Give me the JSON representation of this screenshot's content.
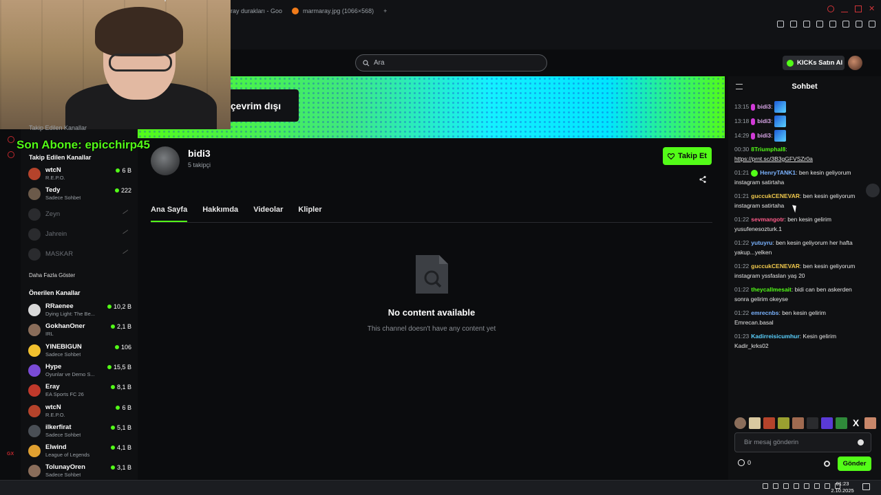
{
  "browser": {
    "tabs": [
      {
        "label": "ray durakları - Goo"
      },
      {
        "label": "marmaray.jpg (1066×568)"
      }
    ],
    "new_tab_label": "+"
  },
  "header": {
    "search_placeholder": "Ara",
    "kicks_label": "KICKs Satın Al"
  },
  "banner": {
    "status_label": "çevrim dışı"
  },
  "overlay": {
    "last_sub_text": "Son Abone: epicchirp45"
  },
  "sidebar": {
    "partial_heading": "Takip Edilen Kanallar",
    "following_heading": "Takip Edilen Kanallar",
    "following": [
      {
        "name": "wtcN",
        "sub": "R.E.P.O.",
        "viewers": "6 B",
        "live": true,
        "color": "#b5432b"
      },
      {
        "name": "Tedy",
        "sub": "Sadece Sohbet",
        "viewers": "222",
        "live": true,
        "color": "#6b5a4a"
      },
      {
        "name": "Zeyn",
        "live": false
      },
      {
        "name": "Jahrein",
        "live": false
      },
      {
        "name": "MASKAR",
        "live": false
      }
    ],
    "show_more": "Daha Fazla Göster",
    "suggested_heading": "Önerilen Kanallar",
    "suggested": [
      {
        "name": "RRaenee",
        "sub": "Dying Light: The Be...",
        "viewers": "10,2 B",
        "color": "#d9d9d9"
      },
      {
        "name": "GokhanOner",
        "sub": "IRL",
        "viewers": "2,1 B",
        "color": "#8a6d5a"
      },
      {
        "name": "YINEBIGUN",
        "sub": "Sadece Sohbet",
        "viewers": "106",
        "color": "#f2c12e"
      },
      {
        "name": "Hype",
        "sub": "Oyunlar ve Demo S...",
        "viewers": "15,5 B",
        "color": "#7a4bd6"
      },
      {
        "name": "Eray",
        "sub": "EA Sports FC 26",
        "viewers": "8,1 B",
        "color": "#c0392b"
      },
      {
        "name": "wtcN",
        "sub": "R.E.P.O.",
        "viewers": "6 B",
        "color": "#b5432b"
      },
      {
        "name": "ilkerfirat",
        "sub": "Sadece Sohbet",
        "viewers": "5,1 B",
        "color": "#4a4f55"
      },
      {
        "name": "Elwind",
        "sub": "League of Legends",
        "viewers": "4,1 B",
        "color": "#e0a030"
      },
      {
        "name": "TolunayOren",
        "sub": "Sadece Sohbet",
        "viewers": "3,1 B",
        "color": "#8a6d5a"
      }
    ],
    "rail_label": "GX"
  },
  "channel": {
    "name": "bidi3",
    "followers": "5 takipçi",
    "follow_label": "Takip Et",
    "tabs": [
      "Ana Sayfa",
      "Hakkımda",
      "Videolar",
      "Klipler"
    ],
    "empty_title": "No content available",
    "empty_subtitle": "This channel doesn't have any content yet"
  },
  "chat": {
    "title": "Sohbet",
    "messages": [
      {
        "time": "13:15",
        "user": "bidi3",
        "text": "",
        "emote": true,
        "color": "#d9a7e8"
      },
      {
        "time": "13:18",
        "user": "bidi3",
        "text": "",
        "emote": true,
        "color": "#d9a7e8"
      },
      {
        "time": "14:29",
        "user": "bidi3",
        "text": "",
        "emote": true,
        "color": "#d9a7e8"
      },
      {
        "time": "00:30",
        "user": "8Triumphal8",
        "text": "https://prnt.sc/3B3gGFVSZr0a",
        "color": "#53fc18"
      },
      {
        "time": "01:21",
        "user": "HenryTANK1",
        "text": "ben kesin geliyorum instagram satirtaha",
        "color": "#7bb3ff"
      },
      {
        "time": "01:21",
        "user": "guccukCENEVAR",
        "text": "ben kesin geliyorum instagram satirtaha",
        "color": "#f2c94c"
      },
      {
        "time": "01:22",
        "user": "sevmangotr",
        "text": "ben kesin gelirim yusufenesozturk.1",
        "color": "#ff5c8a"
      },
      {
        "time": "01:22",
        "user": "yutuyru",
        "text": "ben kesin geliyorum her hafta yakup...yelken",
        "color": "#7bb3ff"
      },
      {
        "time": "01:22",
        "user": "guccukCENEVAR",
        "text": "ben kesin geliyorum instagram yssfaslan yaş 20",
        "color": "#f2c94c"
      },
      {
        "time": "01:22",
        "user": "theycallmesait",
        "text": "bidi can ben askerden sonra gelirim okeyse",
        "color": "#53fc18"
      },
      {
        "time": "01:22",
        "user": "emrecnbs",
        "text": "ben kesin gelirim Emrecan.basal",
        "color": "#7bb3ff"
      },
      {
        "time": "01:23",
        "user": "Kadirreisicumhur",
        "text": "Kesin gelirim Kadir_krks02",
        "color": "#5ad1ff"
      }
    ],
    "input_placeholder": "Bir mesaj gönderin",
    "points": "0",
    "send_label": "Gönder",
    "emote_bar_x": "X"
  },
  "taskbar": {
    "time": "01:23",
    "date": "2.10.2025"
  }
}
